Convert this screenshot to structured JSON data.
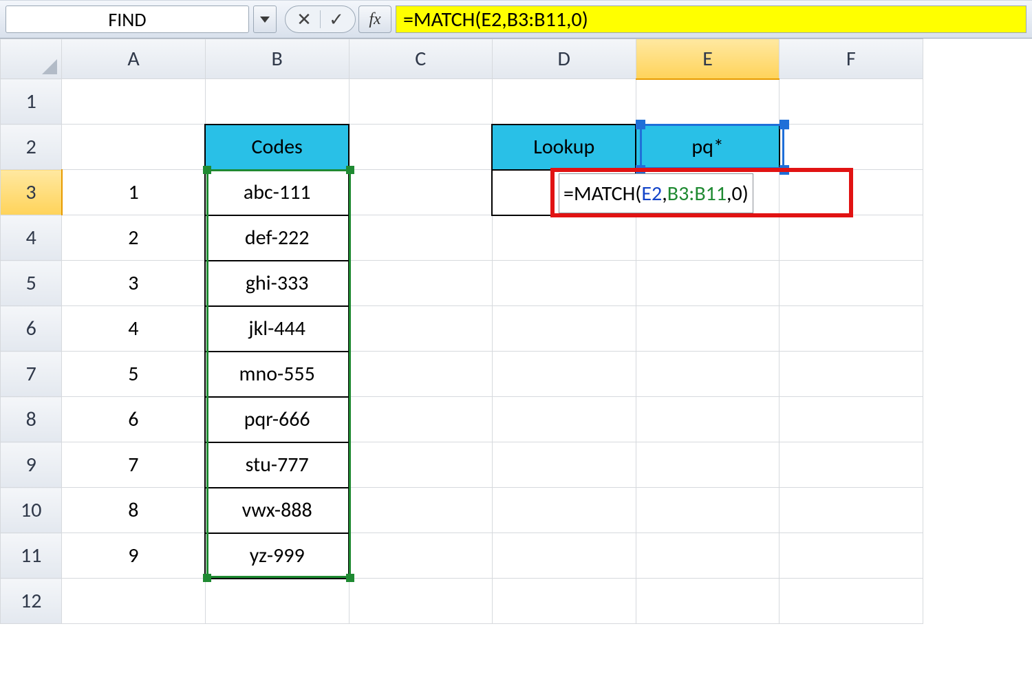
{
  "formula_bar": {
    "name_box": "FIND",
    "cancel_glyph": "✕",
    "enter_glyph": "✓",
    "fx_label": "fx",
    "formula_text": "=MATCH(E2,B3:B11,0)"
  },
  "columns": [
    "A",
    "B",
    "C",
    "D",
    "E",
    "F"
  ],
  "rows": [
    "1",
    "2",
    "3",
    "4",
    "5",
    "6",
    "7",
    "8",
    "9",
    "10",
    "11",
    "12"
  ],
  "active_column": "E",
  "active_row": "3",
  "headers": {
    "codes": "Codes",
    "lookup": "Lookup",
    "lookup_value": "pq*"
  },
  "index_numbers": [
    "1",
    "2",
    "3",
    "4",
    "5",
    "6",
    "7",
    "8",
    "9"
  ],
  "codes": [
    "abc-111",
    "def-222",
    "ghi-333",
    "jkl-444",
    "mno-555",
    "pqr-666",
    "stu-777",
    "vwx-888",
    "yz-999"
  ],
  "typed_formula": {
    "eq": "=",
    "fn": "MATCH(",
    "ref1": "E2",
    "sep1": ",",
    "ref2": "B3:B11",
    "sep2": ",",
    "arg3": "0",
    "close": ")"
  },
  "chart_data": {
    "type": "table",
    "title": "Codes",
    "categories": [
      "1",
      "2",
      "3",
      "4",
      "5",
      "6",
      "7",
      "8",
      "9"
    ],
    "values": [
      "abc-111",
      "def-222",
      "ghi-333",
      "jkl-444",
      "mno-555",
      "pqr-666",
      "stu-777",
      "vwx-888",
      "yz-999"
    ],
    "lookup_label": "Lookup",
    "lookup_value": "pq*",
    "formula": "=MATCH(E2,B3:B11,0)"
  }
}
